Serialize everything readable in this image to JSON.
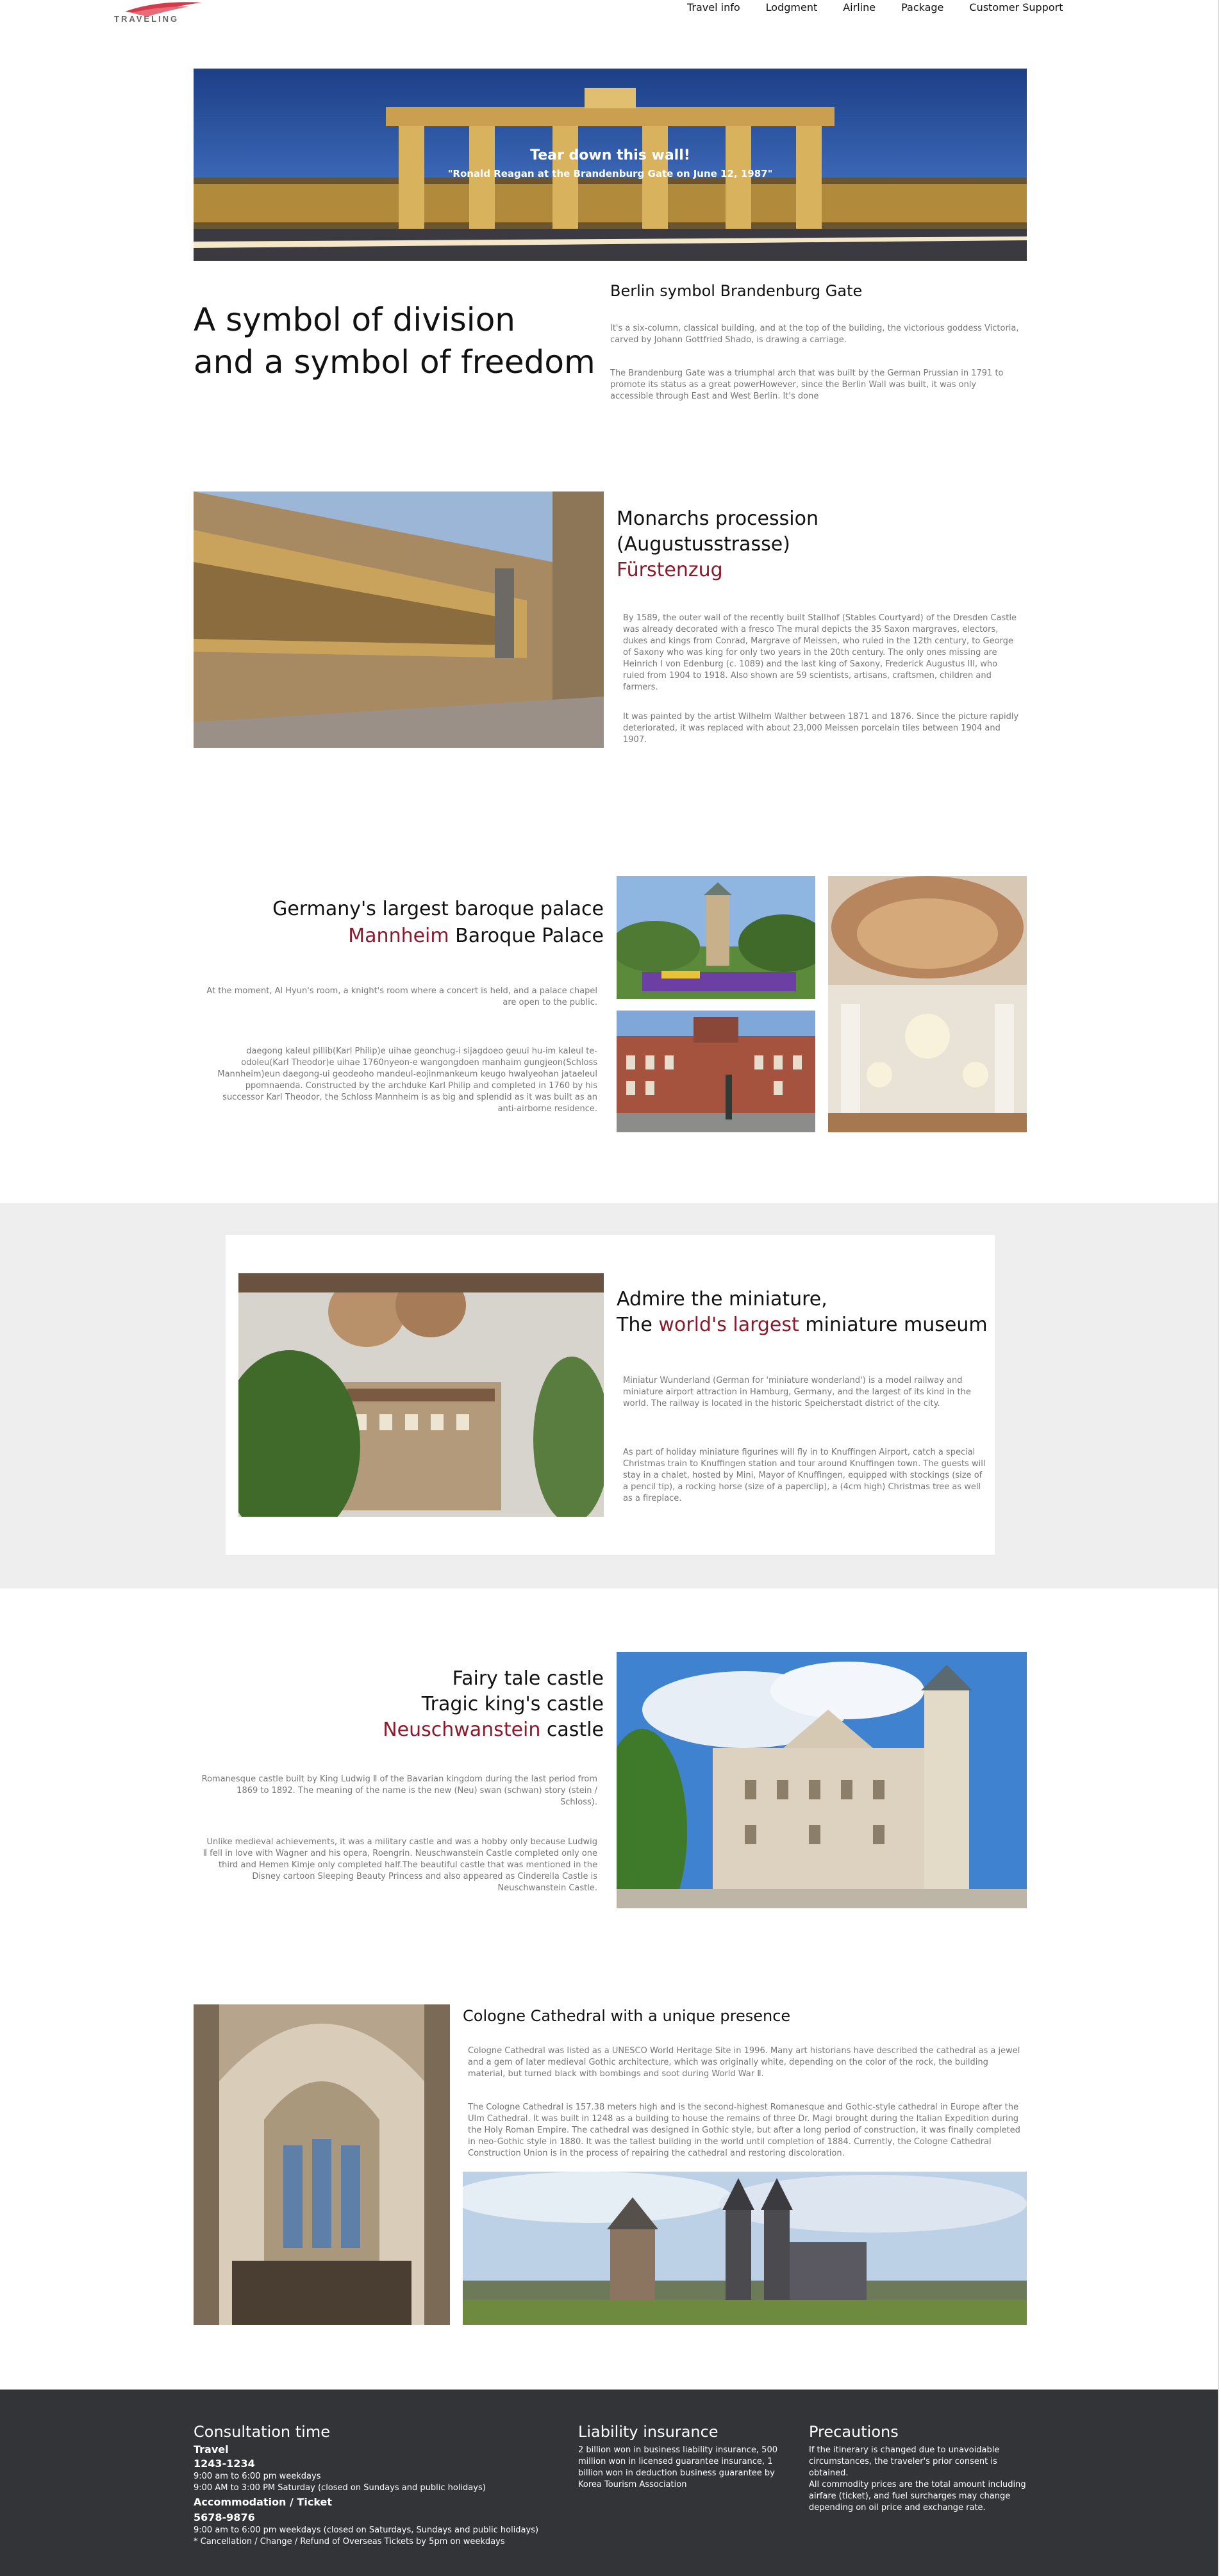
{
  "header": {
    "logo_text": "TRAVELING",
    "nav": [
      "Travel info",
      "Lodgment",
      "Airline",
      "Package",
      "Customer Support"
    ]
  },
  "hero": {
    "quote": "Tear down this wall!",
    "caption": "\"Ronald Reagan at the Brandenburg Gate on June 12, 1987\""
  },
  "brandenburg": {
    "big_title_line1": "A symbol of division",
    "big_title_line2": "and a symbol of freedom",
    "title": "Berlin symbol Brandenburg Gate",
    "p1": "It's a six-column, classical building, and at the top of the building, the victorious goddess Victoria, carved by Johann Gottfried Shado, is drawing a carriage.",
    "p2": "The Brandenburg Gate was a triumphal arch that was built by the German Prussian in 1791 to promote its status as a great powerHowever, since the Berlin Wall was built, it was only accessible through East and West Berlin. It's done"
  },
  "monarchs": {
    "title_line1": "Monarchs procession",
    "title_line2": "(Augustusstrasse)",
    "title_line3": "Fürstenzug",
    "p1": "By 1589, the outer wall of the recently built Stallhof (Stables Courtyard) of the Dresden Castle was already decorated with a fresco The mural depicts the 35 Saxon margraves, electors, dukes and kings from Conrad, Margrave of Meissen, who ruled in the 12th century, to George of Saxony who was king for only two years in the 20th century. The only ones missing are Heinrich I von Edenburg (c. 1089) and the last king of Saxony, Frederick Augustus III, who ruled from 1904 to 1918. Also shown are 59 scientists, artisans, craftsmen, children and farmers.",
    "p2": "It was painted by the artist Wilhelm Walther between 1871 and 1876. Since the picture rapidly deteriorated, it was replaced with about 23,000 Meissen porcelain tiles between 1904 and 1907."
  },
  "baroque": {
    "title_line1": "Germany's largest baroque palace",
    "title_accent": "Mannheim",
    "title_rest": " Baroque Palace",
    "p1": "At the moment, Al Hyun's room, a knight's room where a concert is held, and a palace chapel are open to the public.",
    "p2": "daegong kaleul pillib(Karl Philip)e uihae geonchug-i sijagdoeo geuui hu-im kaleul te-odoleu(Karl Theodor)e uihae 1760nyeon-e wangongdoen manhaim gungjeon(Schloss Mannheim)eun daegong-ui geodeoho mandeul-eojinmankeum keugo hwalyeohan jataeleul ppomnaenda. Constructed by the archduke Karl Philip and completed in 1760 by his successor Karl Theodor, the Schloss Mannheim is as big and splendid as it was built as an anti-airborne residence."
  },
  "miniature": {
    "title_line1": "Admire the miniature,",
    "title_pre": "The ",
    "title_accent": "world's largest",
    "title_post": " miniature museum",
    "p1": "Miniatur Wunderland (German for 'miniature wonderland') is a model railway and miniature airport attraction in Hamburg, Germany, and the largest of its kind in the world. The railway is located in the historic Speicherstadt district of the city.",
    "p2": "As part of holiday miniature figurines will fly in to Knuffingen Airport, catch a special Christmas train to Knuffingen station and tour around Knuffingen town. The guests will stay in a chalet, hosted by Mini, Mayor of Knuffingen, equipped with stockings (size of a pencil tip), a rocking horse (size of a paperclip), a (4cm high) Christmas tree as well as a fireplace."
  },
  "castle": {
    "title_line1": "Fairy tale castle",
    "title_line2": "Tragic king's castle",
    "title_accent": "Neuschwanstein",
    "title_rest": " castle",
    "p1": "Romanesque castle built by King Ludwig Ⅱ of the Bavarian kingdom during the last period from 1869 to 1892. The meaning of the name is the new (Neu) swan (schwan) story (stein / Schloss).",
    "p2": "Unlike medieval achievements, it was a military castle and was a hobby only because Ludwig Ⅱ fell in love with Wagner and his opera, Roengrin. Neuschwanstein Castle completed only one third and Hemen Kimje only completed half.The beautiful castle that was mentioned in the Disney cartoon Sleeping Beauty Princess and also appeared as Cinderella Castle is Neuschwanstein Castle."
  },
  "cologne": {
    "title": "Cologne Cathedral with a unique presence",
    "p1": "Cologne Cathedral was listed as a UNESCO World Heritage Site in 1996. Many art historians have described the cathedral as a jewel and a gem of later medieval Gothic architecture, which was originally white, depending on the color of the rock, the building material, but turned black with bombings and soot during World War Ⅱ.",
    "p2": "The Cologne Cathedral is 157.38 meters high and is the second-highest Romanesque and Gothic-style cathedral in Europe after the Ulm Cathedral. It was built in 1248 as a building to house the remains of three Dr. Magi brought during the Italian Expedition during the Holy Roman Empire. The cathedral was designed in Gothic style, but after a long period of construction, it was finally completed in neo-Gothic style in 1880. It was the tallest building in the world until completion of 1884. Currently, the Cologne Cathedral Construction Union is in the process of repairing the cathedral and restoring discoloration."
  },
  "footer": {
    "consult_title": "Consultation time",
    "travel_label": "Travel",
    "travel_phone": "1243-1234",
    "travel_hours1": "9:00 am to 6:00 pm weekdays",
    "travel_hours2": "9:00 AM to 3:00 PM Saturday (closed on Sundays and public holidays)",
    "accom_label": "Accommodation / Ticket",
    "accom_phone": "5678-9876",
    "accom_hours": "9:00 am to 6:00 pm weekdays (closed on Saturdays, Sundays and public holidays)",
    "accom_note": "* Cancellation / Change / Refund of Overseas Tickets by 5pm on weekdays",
    "liability_title": "Liability insurance",
    "liability_text": "2 billion won in business liability insurance, 500 million won in licensed guarantee insurance, 1 billion won in deduction business guarantee by Korea Tourism Association",
    "precautions_title": "Precautions",
    "precautions_text1": "If the itinerary is changed due to unavoidable circumstances, the traveler's prior consent is obtained.",
    "precautions_text2": "All commodity prices are the total amount including airfare (ticket), and fuel surcharges may change depending on oil price and exchange rate."
  },
  "colors": {
    "accent": "#8b1a2b",
    "footer_bg": "#323438",
    "gray_band": "#eeeeee"
  }
}
